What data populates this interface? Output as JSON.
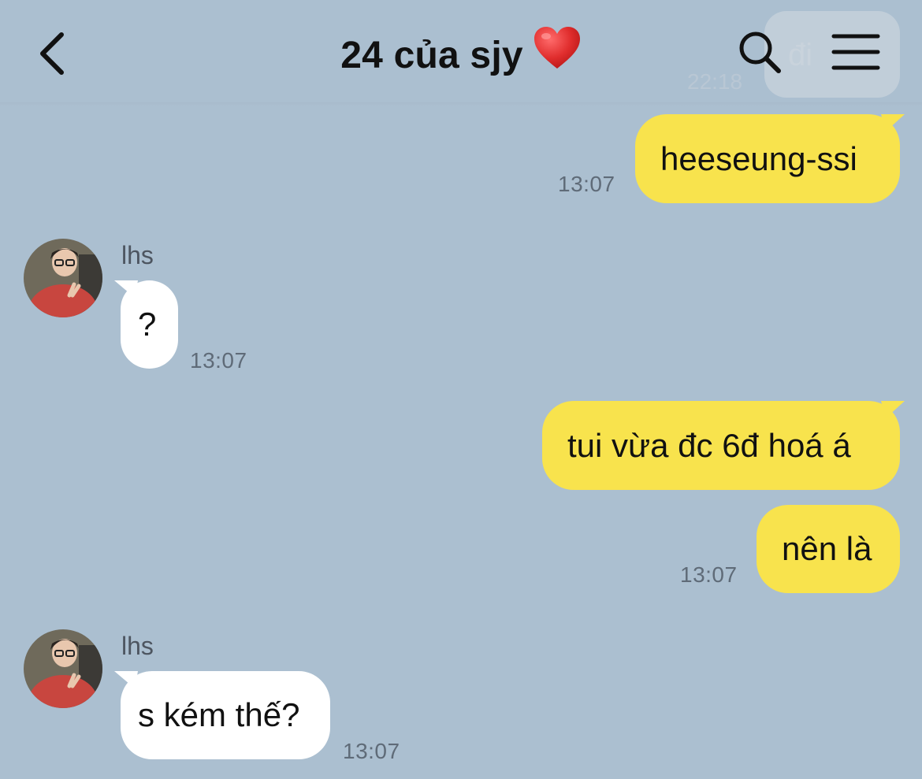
{
  "header": {
    "title": "24 của sjy",
    "title_emoji": "heart",
    "background": "#abbfd0"
  },
  "ghost_message": {
    "text": "đi",
    "time": "22:18"
  },
  "colors": {
    "outgoing_bubble": "#f8e34d",
    "incoming_bubble": "#ffffff",
    "timestamp": "#5f6b78",
    "heart": "#e02d2d"
  },
  "messages": [
    {
      "direction": "out",
      "text": "heeseung-ssi",
      "time": "13:07"
    },
    {
      "direction": "in",
      "sender": "lhs",
      "text": "?",
      "time": "13:07"
    },
    {
      "direction": "out",
      "text": "tui vừa đc 6đ hoá á",
      "time": ""
    },
    {
      "direction": "out",
      "text": "nên là",
      "time": "13:07"
    },
    {
      "direction": "in",
      "sender": "lhs",
      "text": "s kém thế?",
      "time": "13:07"
    }
  ],
  "icons": {
    "back": "chevron-left-icon",
    "search": "search-icon",
    "menu": "hamburger-menu-icon",
    "avatar": "avatar"
  }
}
